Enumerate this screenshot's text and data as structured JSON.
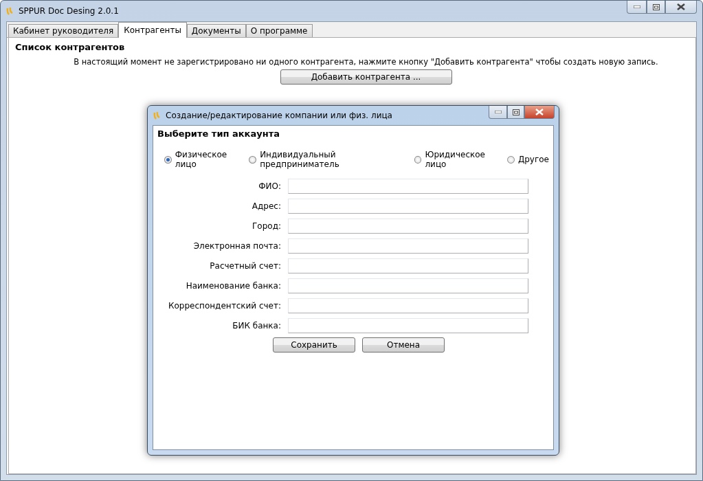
{
  "window": {
    "title": "SPPUR Doc Desing 2.0.1"
  },
  "tabs": [
    {
      "label": "Кабинет руководителя",
      "selected": false
    },
    {
      "label": "Контрагенты",
      "selected": true
    },
    {
      "label": "Документы",
      "selected": false
    },
    {
      "label": "О программе",
      "selected": false
    }
  ],
  "heading": "Список контрагентов",
  "empty_message": "В настоящий момент не зарегистрировано ни одного контрагента, нажмите кнопку \"Добавить контрагента\" чтобы создать новую запись.",
  "add_button": "Добавить контрагента ...",
  "dialog": {
    "title": "Создание/редактирование компании или физ. лица",
    "heading": "Выберите тип аккаунта",
    "account_types": [
      {
        "label": "Физическое лицо",
        "selected": true
      },
      {
        "label": "Индивидуальный предприниматель",
        "selected": false
      },
      {
        "label": "Юридическое лицо",
        "selected": false
      },
      {
        "label": "Другое",
        "selected": false
      }
    ],
    "fields": [
      {
        "label": "ФИО:"
      },
      {
        "label": "Адрес:"
      },
      {
        "label": "Город:"
      },
      {
        "label": "Электронная почта:"
      },
      {
        "label": "Расчетный счет:"
      },
      {
        "label": "Наименование банка:"
      },
      {
        "label": "Корреспондентский счет:"
      },
      {
        "label": "БИК банка:"
      }
    ],
    "buttons": [
      "Сохранить",
      "Отмена"
    ]
  }
}
